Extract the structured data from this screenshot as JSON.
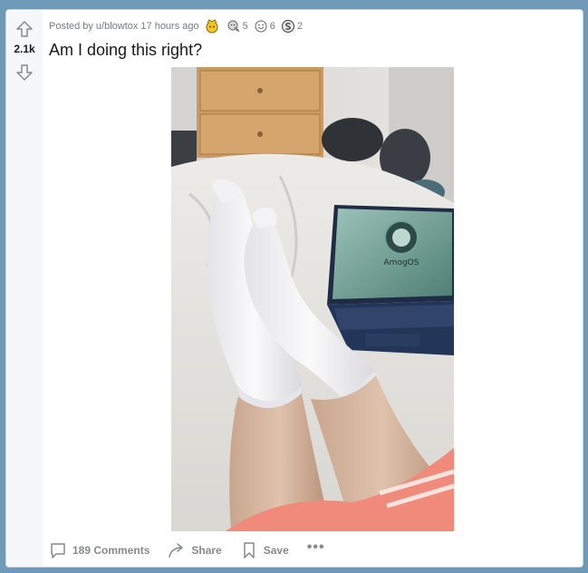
{
  "post": {
    "posted_by_prefix": "Posted by",
    "username": "u/blowtox",
    "time_ago": "17 hours ago",
    "awards": [
      {
        "icon": "gold-award-icon",
        "count": ""
      },
      {
        "icon": "silver-award-icon",
        "count": "5"
      },
      {
        "icon": "helpful-award-icon",
        "count": "6"
      },
      {
        "icon": "coin-award-icon",
        "count": "2"
      }
    ],
    "title": "Am I doing this right?",
    "votes": "2.1k",
    "laptop_screen_text": "AmogOS"
  },
  "actions": {
    "comments_label": "189 Comments",
    "share_label": "Share",
    "save_label": "Save",
    "more_label": "•••"
  },
  "colors": {
    "background": "#6e9ab8",
    "card": "#ffffff",
    "vote_column": "#f6f7f8",
    "meta_text": "#787c7e",
    "title_text": "#1a1a1b"
  }
}
